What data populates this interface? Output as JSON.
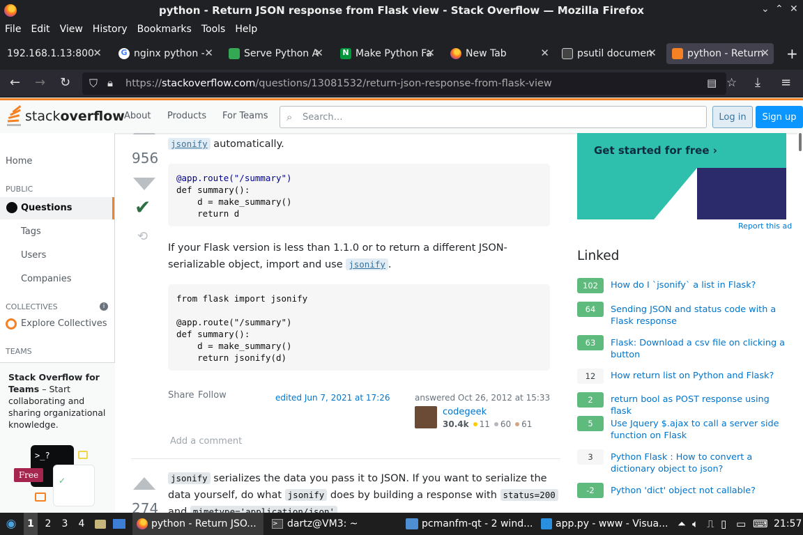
{
  "window": {
    "title": "python - Return JSON response from Flask view - Stack Overflow — Mozilla Firefox"
  },
  "menu": [
    "File",
    "Edit",
    "View",
    "History",
    "Bookmarks",
    "Tools",
    "Help"
  ],
  "tabs": [
    {
      "label": "192.168.1.13:800",
      "icon": "page-icon",
      "color": "#5b5b66"
    },
    {
      "label": "nginx python -",
      "icon": "google-icon",
      "color": "#4285f4"
    },
    {
      "label": "Serve Python A",
      "icon": "map-pin-icon",
      "color": "#34a853"
    },
    {
      "label": "Make Python Fa",
      "icon": "nginx-icon",
      "color": "#009639"
    },
    {
      "label": "New Tab",
      "icon": "firefox-icon",
      "color": "#ff7a18"
    },
    {
      "label": "psutil documen",
      "icon": "doc-icon",
      "color": "#cccccc"
    },
    {
      "label": "python - Return",
      "icon": "stackoverflow-icon",
      "color": "#f48225"
    }
  ],
  "url": {
    "prefix": "https://",
    "domain": "stackoverflow.com",
    "path": "/questions/13081532/return-json-response-from-flask-view"
  },
  "so": {
    "logo_a": "stack",
    "logo_b": "overflow",
    "nav": [
      "About",
      "Products",
      "For Teams"
    ],
    "search_placeholder": "Search…",
    "login": "Log in",
    "signup": "Sign up"
  },
  "leftnav": {
    "home": "Home",
    "public": "PUBLIC",
    "questions": "Questions",
    "tags": "Tags",
    "users": "Users",
    "companies": "Companies",
    "collectives": "COLLECTIVES",
    "explore": "Explore Collectives",
    "teams": "TEAMS",
    "teams_title": "Stack Overflow for Teams",
    "teams_desc": " – Start collaborating and sharing organizational knowledge.",
    "free": "Free",
    "prompt": ">_?"
  },
  "answer1": {
    "votes": "956",
    "intro_code": "jsonify",
    "intro_text": " automatically.",
    "code1": [
      "@app.route(\"/summary\")",
      "def summary():",
      "    d = make_summary()",
      "    return d"
    ],
    "p2a": "If your Flask version is less than 1.1.0 or to return a different JSON-serializable",
    "p2b": "object, import and use ",
    "p2code": "jsonify",
    "p2end": ".",
    "code2": [
      "from flask import jsonify",
      "",
      "@app.route(\"/summary\")",
      "def summary():",
      "    d = make_summary()",
      "    return jsonify(d)"
    ],
    "share": "Share",
    "follow": "Follow",
    "edited": "edited Jun 7, 2021 at 17:26",
    "answered": "answered Oct 26, 2012 at 15:33",
    "user": "codegeek",
    "rep": "30.4k",
    "gold": "11",
    "silver": "60",
    "bronze": "61",
    "add_comment": "Add a comment"
  },
  "answer2": {
    "votes": "274",
    "code_a": "jsonify",
    "text_a": " serializes the data you pass it to JSON. If you want to serialize the data",
    "text_b": "yourself, do what ",
    "code_b": "jsonify",
    "text_c": " does by building a response with ",
    "code_c": "status=200",
    "text_d": " and",
    "code_d": "mimetype='application/json'",
    "text_e": "."
  },
  "ad": {
    "cta": "Get started for free ›",
    "report": "Report this ad"
  },
  "linked": {
    "title": "Linked",
    "items": [
      {
        "count": "102",
        "answered": true,
        "text": "How do I `jsonify` a list in Flask?"
      },
      {
        "count": "64",
        "answered": true,
        "text": "Sending JSON and status code with a Flask response"
      },
      {
        "count": "63",
        "answered": true,
        "text": "Flask: Download a csv file on clicking a button"
      },
      {
        "count": "12",
        "answered": false,
        "text": "How return list on Python and Flask?"
      },
      {
        "count": "2",
        "answered": true,
        "text": "return bool as POST response using flask"
      },
      {
        "count": "5",
        "answered": true,
        "text": "Use Jquery $.ajax to call a server side function on Flask"
      },
      {
        "count": "3",
        "answered": false,
        "text": "Python Flask : How to convert a dictionary object to json?"
      },
      {
        "count": "-2",
        "answered": true,
        "text": "Python 'dict' object not callable?"
      }
    ]
  },
  "taskbar": {
    "workspaces": [
      "1",
      "2",
      "3",
      "4"
    ],
    "items": [
      "python - Return JSO...",
      "dartz@VM3: ~",
      "pcmanfm-qt - 2 wind...",
      "app.py - www - Visua..."
    ],
    "clock": "21:57"
  }
}
